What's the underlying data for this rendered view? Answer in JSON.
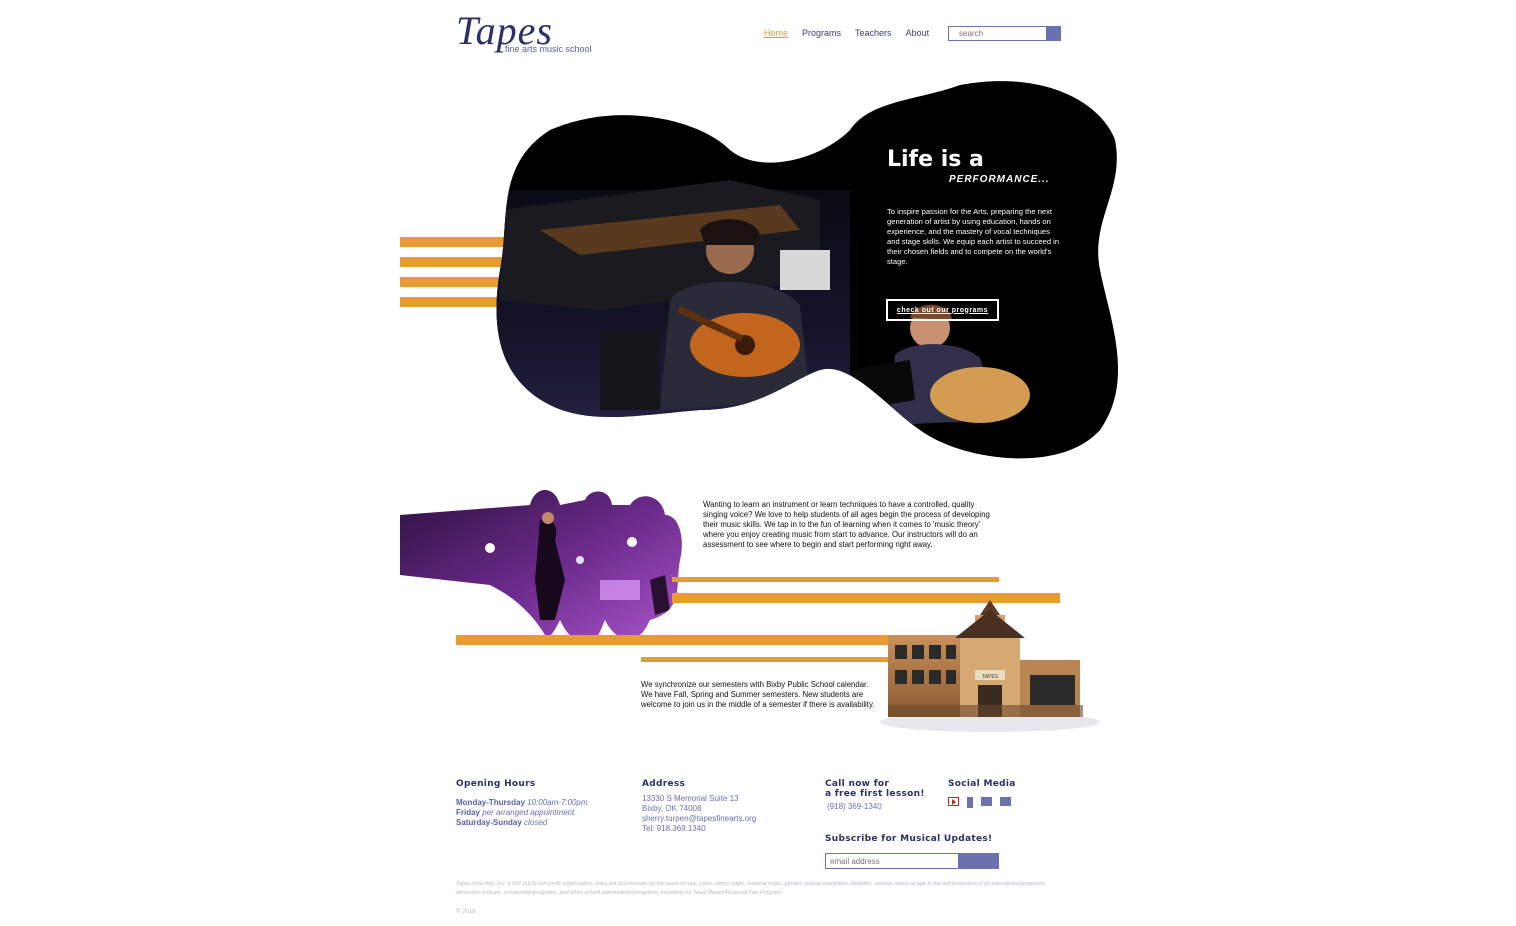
{
  "header": {
    "logo_title": "Tapes",
    "logo_subtitle": "fine arts music school",
    "nav": [
      "Home",
      "Programs",
      "Teachers",
      "About"
    ],
    "search_placeholder": "search"
  },
  "hero": {
    "title": "Life is a",
    "subtitle": "PERFORMANCE...",
    "body": "To inspire passion for the Arts, preparing the next generation of artist by using education, hands on experience, and the mastery of vocal techniques and stage skills. We equip each artist to succeed in their chosen fields and to compete on the world's stage.",
    "button": "check out our programs"
  },
  "middle": {
    "text1": "Wanting to learn an instrument or learn techniques to have a controlled, quality singing voice? We love to help students of all ages begin the process of developing their music skills. We tap in to the fun of learning when it comes to 'music theory' where you enjoy creating music from start to advance. Our instructors will do an assessment to see where to begin and start performing right away.",
    "text2": "We synchronize our semesters with Bixby Public School calendar. We have Fall, Spring and Summer semesters. New students are welcome to join us in the middle of a semester if there is availability.",
    "building_sign": "TAPES"
  },
  "footer": {
    "hours_heading": "Opening Hours",
    "hours": [
      {
        "day": "Monday-Thursday",
        "time": "10:00am-7:00pm"
      },
      {
        "day": "Friday",
        "time": "per arranged appointment"
      },
      {
        "day": "Saturday-Sunday",
        "time": "closed"
      }
    ],
    "address_heading": "Address",
    "address_lines": [
      "13330 S Memorial Suite 13",
      "Bixby, OK 74008",
      "sherry.turpen@tapesfinearts.org",
      "Tel: 918.369.1340"
    ],
    "call_heading_1": "Call now for",
    "call_heading_2": "a free first lesson!",
    "call_phone": "(918) 369-1340",
    "social_heading": "Social Media",
    "social_icons": [
      "youtube-icon",
      "facebook-icon",
      "email-icon",
      "instagram-icon"
    ],
    "subscribe_heading": "Subscribe for Musical Updates!",
    "subscribe_placeholder": "email address",
    "disclaimer": "Tapes Fine Arts, Inc. a 501 (c)(3) non-profit organization, does not discriminate on the basis of race, color, ethnic origin, national origin, gender, sexual orientation, disability, veteran status or age in the administration of its educational programs, admission policies, scholarship programs, and other school administered programs, including our Need Based Reduced Fee Program.",
    "copyright": "© 2019"
  },
  "colors": {
    "accent": "#e89a33",
    "brand": "#2c3068",
    "link": "#6b70b0"
  }
}
